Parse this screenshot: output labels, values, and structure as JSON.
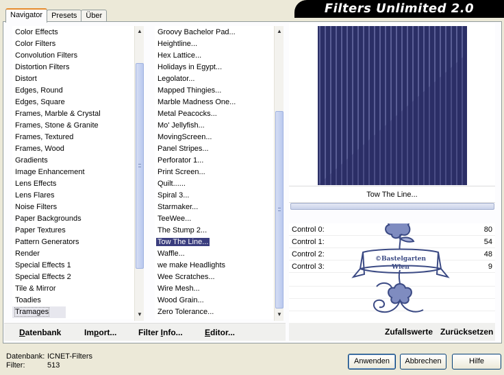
{
  "tabs": [
    "Navigator",
    "Presets",
    "Über"
  ],
  "banner_title": "Filters Unlimited 2.0",
  "categories": [
    "Color Effects",
    "Color Filters",
    "Convolution Filters",
    "Distortion Filters",
    "Distort",
    "Edges, Round",
    "Edges, Square",
    "Frames, Marble & Crystal",
    "Frames, Stone & Granite",
    "Frames, Textured",
    "Frames, Wood",
    "Gradients",
    "Image Enhancement",
    "Lens Effects",
    "Lens Flares",
    "Noise Filters",
    "Paper Backgrounds",
    "Paper Textures",
    "Pattern Generators",
    "Render",
    "Special Effects 1",
    "Special Effects 2",
    "Tile & Mirror",
    "Toadies",
    "Tramages"
  ],
  "filters": [
    "Groovy Bachelor Pad...",
    "Heightline...",
    "Hex Lattice...",
    "Holidays in Egypt...",
    "Legolator...",
    "Mapped Thingies...",
    "Marble Madness One...",
    "Metal Peacocks...",
    "Mo' Jellyfish...",
    "MovingScreen...",
    "Panel Stripes...",
    "Perforator 1...",
    "Print Screen...",
    "Quilt......",
    "Spiral 3...",
    "Starmaker...",
    "TeeWee...",
    "The Stump 2...",
    "Tow The Line...",
    "Waffle...",
    "we make Headlights",
    "Wee Scratches...",
    "Wire Mesh...",
    "Wood Grain...",
    "Zero Tolerance..."
  ],
  "selected_category": "Tramages",
  "selected_filter": "Tow The Line...",
  "left_buttons": {
    "datenbank": {
      "underline": "D",
      "rest": "atenbank"
    },
    "import": {
      "pre": "Im",
      "underline": "p",
      "rest": "ort..."
    },
    "filterinfo": {
      "pre": "Filter ",
      "underline": "I",
      "rest": "nfo..."
    },
    "editor": {
      "underline": "E",
      "rest": "ditor..."
    }
  },
  "preview_filter_name": "Tow The Line...",
  "controls": [
    {
      "label": "Control 0:",
      "value": "80"
    },
    {
      "label": "Control 1:",
      "value": "54"
    },
    {
      "label": "Control 2:",
      "value": "48"
    },
    {
      "label": "Control 3:",
      "value": "9"
    }
  ],
  "watermark": {
    "line1": "©Bastelgarten",
    "line2": "Wien"
  },
  "right_buttons": {
    "randomize": "Zufallswerte",
    "reset": "Zurücksetzen"
  },
  "status": {
    "db_label": "Datenbank:",
    "db_value": "ICNET-Filters",
    "filter_label": "Filter:",
    "filter_value": "513"
  },
  "dialog_buttons": {
    "apply": "Anwenden",
    "cancel": "Abbrechen",
    "help": "Hilfe"
  },
  "colors": {
    "preview_bg": "#2b2f66",
    "preview_stripe": "#5b5f96",
    "selection": "#3a3d7e",
    "stamp": "#3b4a84"
  },
  "icons": [
    "scroll-up-icon",
    "scroll-down-icon",
    "scroll-grip-icon"
  ]
}
